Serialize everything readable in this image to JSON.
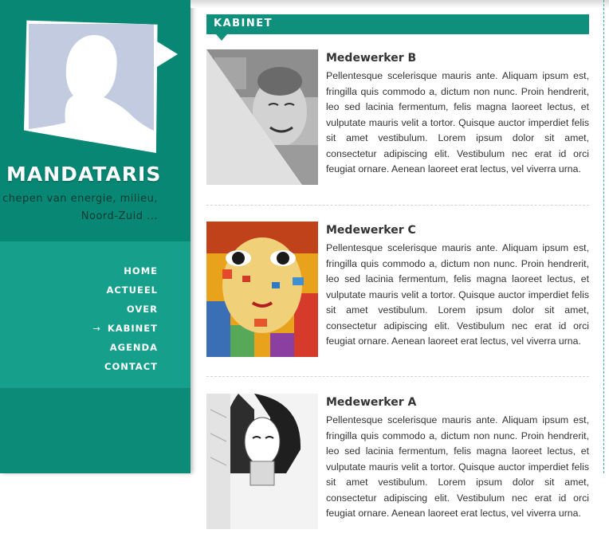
{
  "sidebar": {
    "title": "MANDATARIS",
    "tagline_line1": "chepen van energie, milieu,",
    "tagline_line2": "Noord-Zuid ...",
    "menu": [
      {
        "label": "HOME",
        "active": false
      },
      {
        "label": "ACTUEEL",
        "active": false
      },
      {
        "label": "OVER",
        "active": false
      },
      {
        "label": "KABINET",
        "active": true
      },
      {
        "label": "AGENDA",
        "active": false
      },
      {
        "label": "CONTACT",
        "active": false
      }
    ],
    "active_arrow": "→"
  },
  "section": {
    "title": "KABINET"
  },
  "entries": [
    {
      "name": "Medewerker B",
      "text": "Pellentesque scelerisque mauris ante. Aliquam ipsum est, fringilla quis commodo a, dictum non nunc. Proin hendrerit, leo sed lacinia fermentum, felis magna laoreet lectus, et vulputate mauris velit a tortor. Quisque auctor imperdiet felis sit amet vestibulum. Lorem ipsum dolor sit amet, consectetur adipiscing elit. Vestibulum nec erat id orci feugiat ornare. Aenean laoreet erat lectus, vel viverra urna."
    },
    {
      "name": "Medewerker C",
      "text": "Pellentesque scelerisque mauris ante. Aliquam ipsum est, fringilla quis commodo a, dictum non nunc. Proin hendrerit, leo sed lacinia fermentum, felis magna laoreet lectus, et vulputate mauris velit a tortor. Quisque auctor imperdiet felis sit amet vestibulum. Lorem ipsum dolor sit amet, consectetur adipiscing elit. Vestibulum nec erat id orci feugiat ornare. Aenean laoreet erat lectus, vel viverra urna."
    },
    {
      "name": "Medewerker A",
      "text": "Pellentesque scelerisque mauris ante. Aliquam ipsum est, fringilla quis commodo a, dictum non nunc. Proin hendrerit, leo sed lacinia fermentum, felis magna laoreet lectus, et vulputate mauris velit a tortor. Quisque auctor imperdiet felis sit amet vestibulum. Lorem ipsum dolor sit amet, consectetur adipiscing elit. Vestibulum nec erat id orci feugiat ornare. Aenean laoreet erat lectus, vel viverra urna."
    }
  ],
  "colors": {
    "sidebar": "#088774",
    "menu_panel": "#16a08c",
    "accent": "#0e907d",
    "avatar_silhouette": "#c3cbe0"
  }
}
